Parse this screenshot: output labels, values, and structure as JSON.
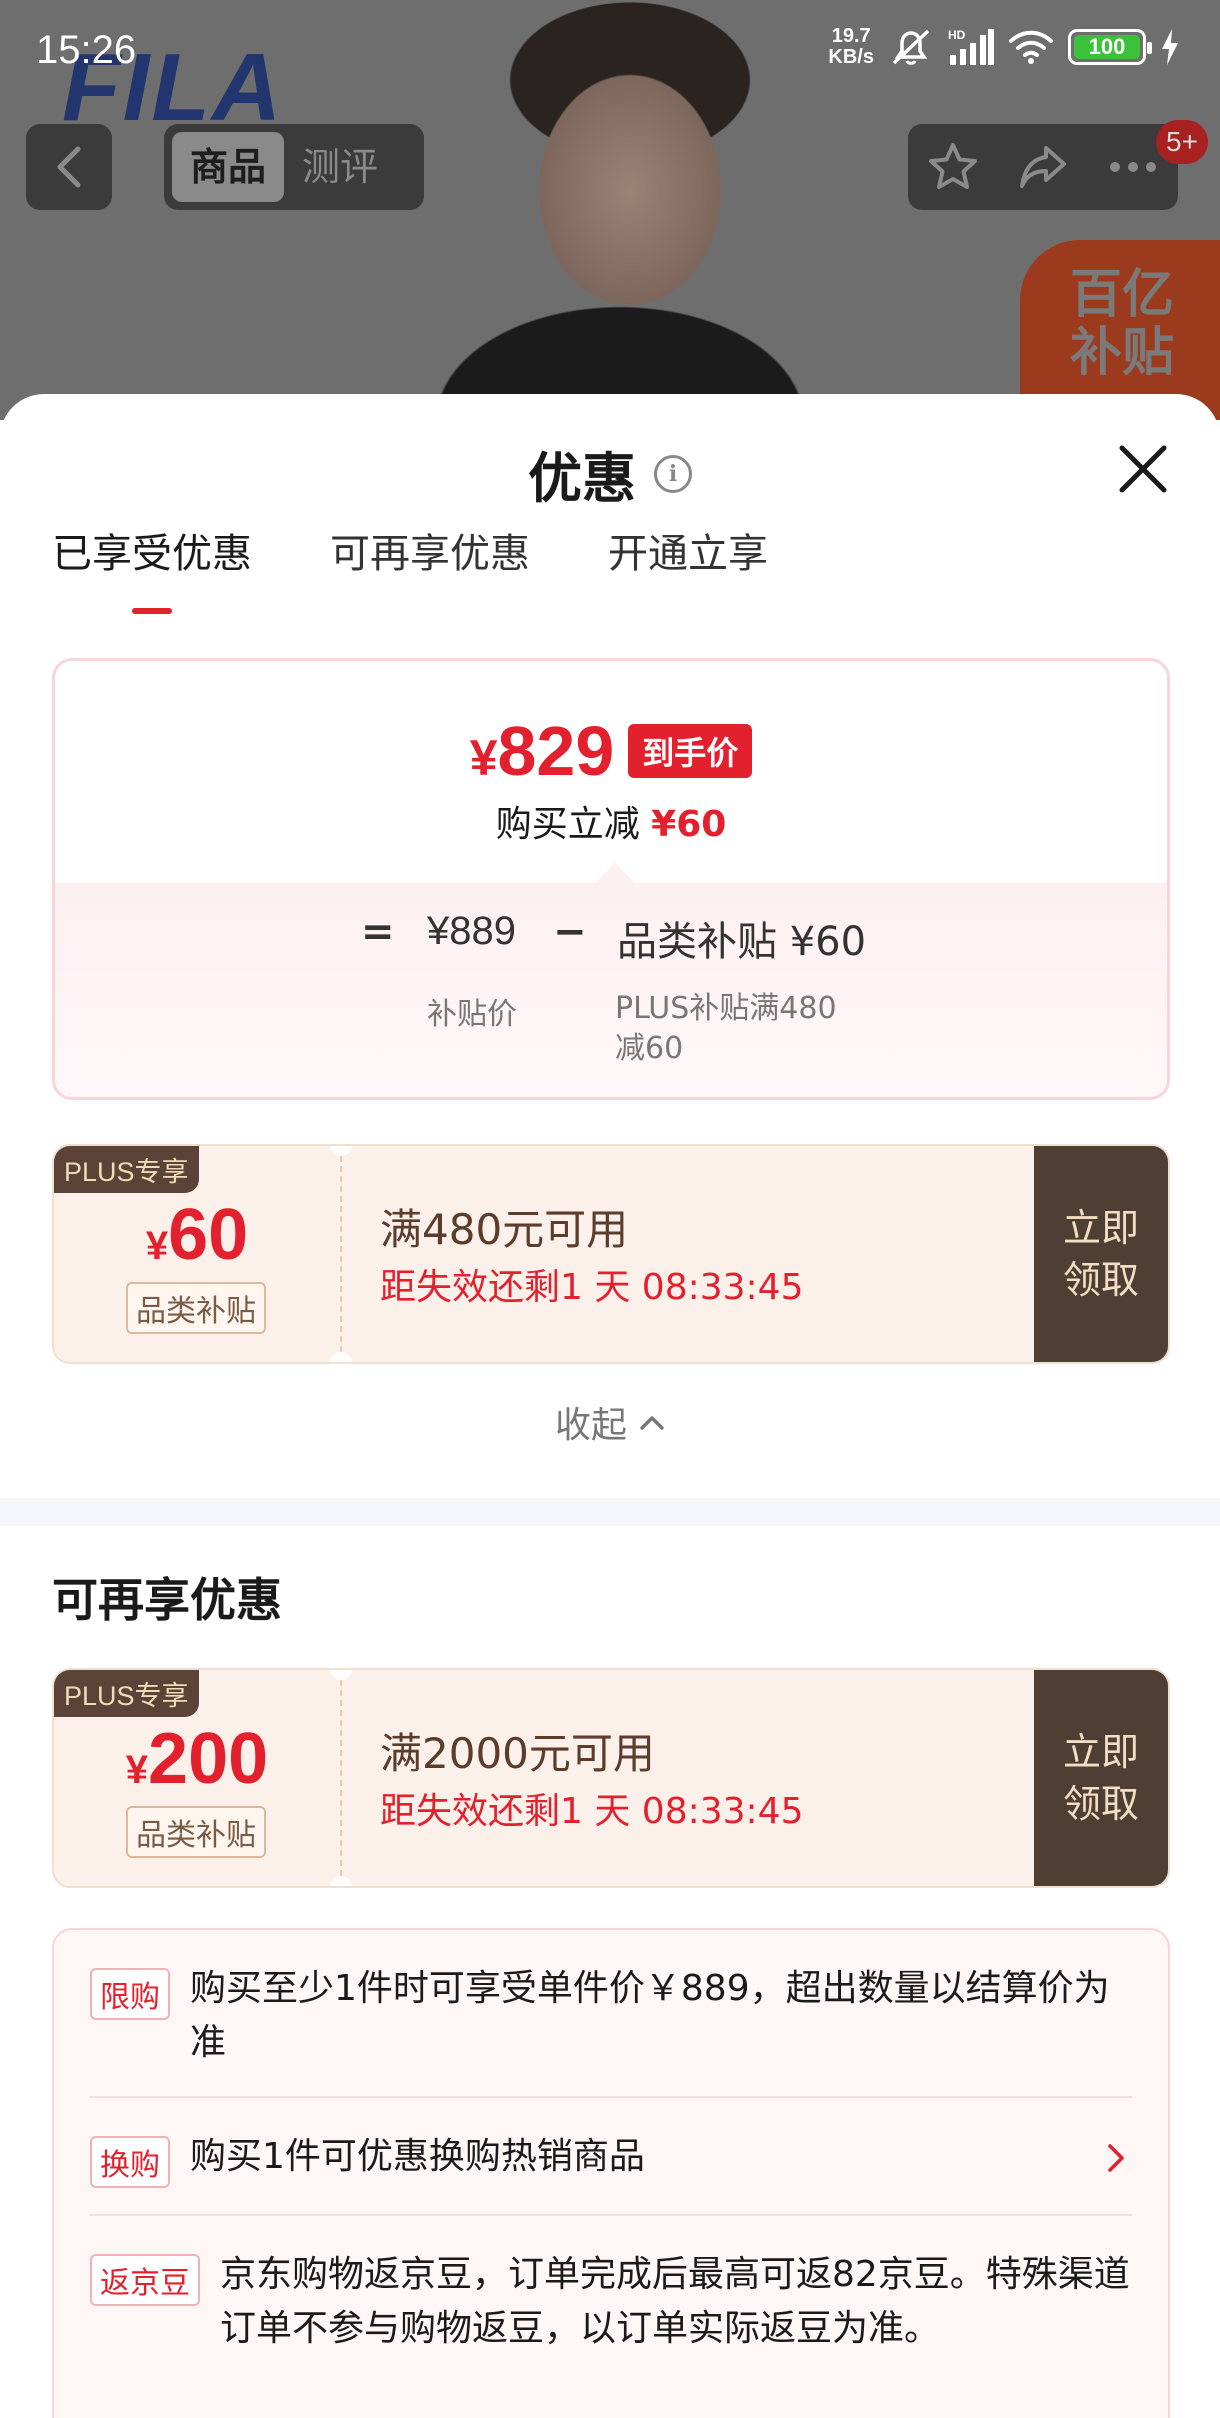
{
  "status_bar": {
    "time": "15:26",
    "net_speed_value": "19.7",
    "net_speed_unit": "KB/s",
    "signal_label": "HD",
    "battery": "100"
  },
  "background_page": {
    "brand_logo": "FILA",
    "tabs": [
      "商品",
      "测评"
    ],
    "active_tab": "商品",
    "badge_count": "5+",
    "promo_badge_line1": "百亿",
    "promo_badge_line2": "补贴"
  },
  "sheet": {
    "title": "优惠",
    "tabs": [
      "已享受优惠",
      "可再享优惠",
      "开通立享"
    ],
    "active_tab_index": 0,
    "price": {
      "currency": "¥",
      "final_price": "829",
      "tag": "到手价",
      "sub_label": "购买立减",
      "sub_amount": "¥60",
      "calc_equals": "=",
      "calc_base": "¥889",
      "calc_minus": "−",
      "calc_discount": "品类补贴 ¥60",
      "note_base": "补贴价",
      "note_discount": "PLUS补贴满480减60"
    },
    "enjoyed_coupon": {
      "badge": "PLUS专享",
      "currency": "¥",
      "amount": "60",
      "type": "品类补贴",
      "condition": "满480元可用",
      "countdown": "距失效还剩1 天 08:33:45",
      "button_line1": "立即",
      "button_line2": "领取"
    },
    "collapse_label": "收起",
    "more_section_title": "可再享优惠",
    "more_coupon": {
      "badge": "PLUS专享",
      "currency": "¥",
      "amount": "200",
      "type": "品类补贴",
      "condition": "满2000元可用",
      "countdown": "距失效还剩1 天 08:33:45",
      "button_line1": "立即",
      "button_line2": "领取"
    },
    "rules": [
      {
        "tag": "限购",
        "text": "购买至少1件时可享受单件价￥889，超出数量以结算价为准"
      },
      {
        "tag": "换购",
        "text": "购买1件可优惠换购热销商品"
      },
      {
        "tag": "返京豆",
        "text": "京东购物返京豆，订单完成后最高可返82京豆。特殊渠道订单不参与购物返豆，以订单实际返豆为准。"
      }
    ]
  },
  "colors": {
    "accent_red": "#e3202d",
    "coupon_dark": "#4f3e33",
    "coupon_bg": "#fbf1ea"
  }
}
